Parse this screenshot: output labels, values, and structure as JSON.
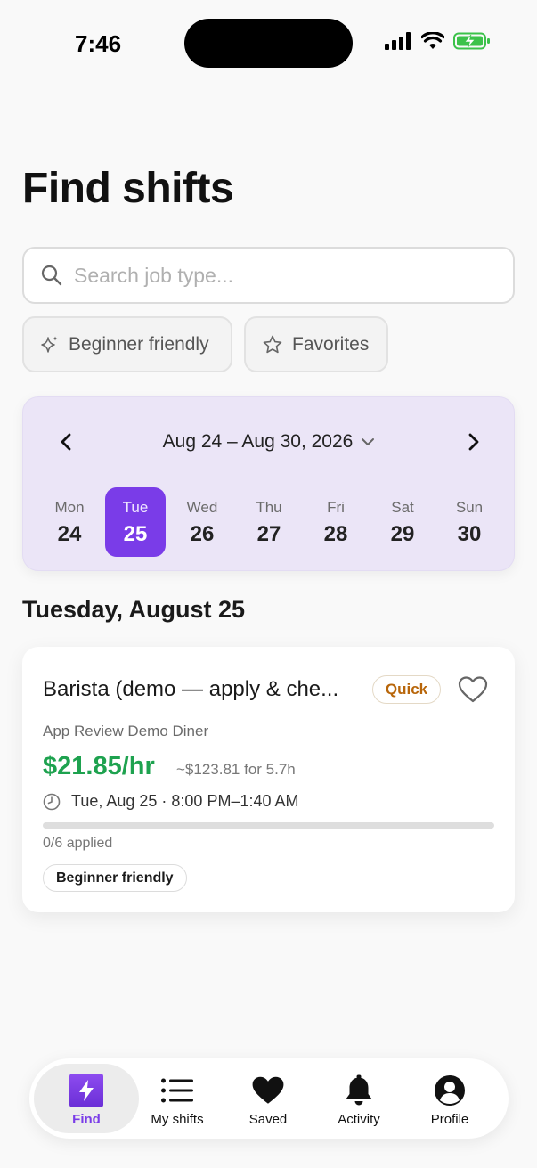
{
  "status_bar": {
    "time": "7:46"
  },
  "page": {
    "title": "Find shifts"
  },
  "search": {
    "placeholder": "Search job type..."
  },
  "filters": {
    "beginner_label": "Beginner friendly",
    "favorites_label": "Favorites"
  },
  "week": {
    "range": "Aug 24 – Aug 30, 2026",
    "days": [
      {
        "name": "Mon",
        "num": "24"
      },
      {
        "name": "Tue",
        "num": "25"
      },
      {
        "name": "Wed",
        "num": "26"
      },
      {
        "name": "Thu",
        "num": "27"
      },
      {
        "name": "Fri",
        "num": "28"
      },
      {
        "name": "Sat",
        "num": "29"
      },
      {
        "name": "Sun",
        "num": "30"
      }
    ],
    "selected_index": 1
  },
  "section": {
    "heading": "Tuesday, August 25"
  },
  "shift": {
    "title": "Barista (demo — apply & che...",
    "badge": "Quick",
    "employer": "App Review Demo Diner",
    "rate": "$21.85/hr",
    "estimate": "~$123.81 for 5.7h",
    "time": "Tue, Aug 25 · 8:00 PM–1:40 AM",
    "applied": "0/6 applied",
    "applied_fraction": 0,
    "tag": "Beginner friendly"
  },
  "tabs": {
    "find": "Find",
    "my_shifts": "My shifts",
    "saved": "Saved",
    "activity": "Activity",
    "profile": "Profile"
  },
  "colors": {
    "accent": "#7a3ce8",
    "rate_green": "#1ea24f",
    "badge_orange": "#b8660a",
    "week_bg": "#ebe5f7"
  }
}
